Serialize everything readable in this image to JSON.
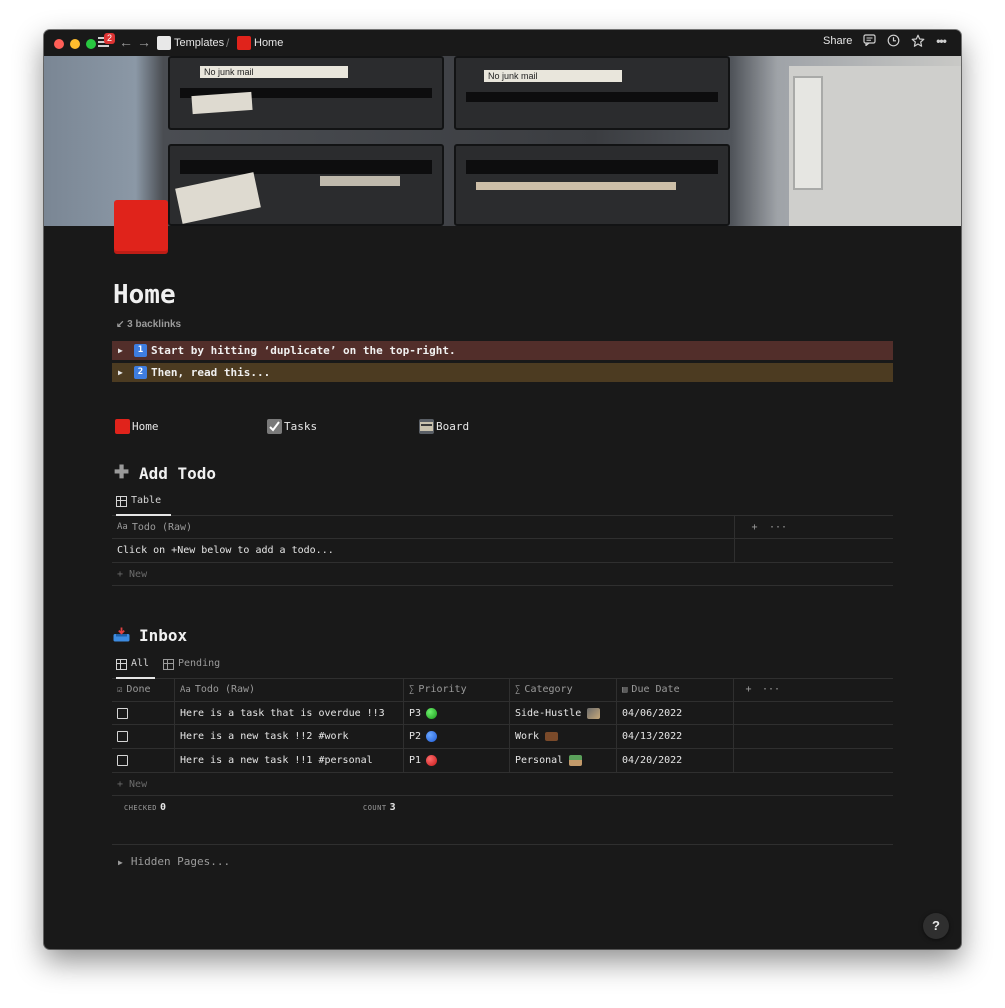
{
  "titlebar": {
    "badge_count": "2",
    "breadcrumb": [
      {
        "label": "Templates"
      },
      {
        "label": "Home"
      }
    ],
    "separator": "/",
    "share_label": "Share",
    "back_glyph": "←",
    "forward_glyph": "→",
    "icons": [
      "comment-icon",
      "clock-icon",
      "star-icon",
      "more-icon"
    ]
  },
  "cover": {
    "mailbox_labels": [
      "No junk mail",
      "No junk mail"
    ]
  },
  "page": {
    "title": "Home",
    "backlinks_arrow": "↙",
    "backlinks": "3 backlinks"
  },
  "callouts": [
    {
      "num": "1",
      "text": "Start by hitting ‘duplicate’ on the top-right.",
      "color": "#522e2a"
    },
    {
      "num": "2",
      "text": "Then, read this...",
      "color": "#4c3b21"
    }
  ],
  "links": [
    {
      "label": "Home"
    },
    {
      "label": "Tasks"
    },
    {
      "label": "Board"
    }
  ],
  "add_todo": {
    "heading": "Add Todo",
    "tab": "Table",
    "column": "Todo (Raw)",
    "hint": "Click on +New below to add a todo...",
    "new_label": "+ New",
    "add_col": "+",
    "more": "···"
  },
  "inbox": {
    "heading": "Inbox",
    "tabs": [
      {
        "label": "All",
        "active": true
      },
      {
        "label": "Pending",
        "active": false
      }
    ],
    "columns": [
      "Done",
      "Todo (Raw)",
      "Priority",
      "Category",
      "Due Date"
    ],
    "column_icons": [
      "☑",
      "Aa",
      "∑",
      "∑",
      "▤"
    ],
    "rows": [
      {
        "todo": "Here is a task that is overdue !!3",
        "priority": "P3",
        "priority_dot": "green",
        "category": "Side-Hustle",
        "due": "04/06/2022"
      },
      {
        "todo": "Here is a new task !!2 #work",
        "priority": "P2",
        "priority_dot": "blue",
        "category": "Work",
        "due": "04/13/2022"
      },
      {
        "todo": "Here is a new task !!1 #personal",
        "priority": "P1",
        "priority_dot": "red",
        "category": "Personal",
        "due": "04/20/2022"
      }
    ],
    "new_label": "+ New",
    "checked_label": "CHECKED",
    "checked_value": "0",
    "count_label": "COUNT",
    "count_value": "3",
    "add_col": "+",
    "more": "···"
  },
  "hidden_pages": {
    "label": "Hidden Pages...",
    "glyph": "▶"
  },
  "help": "?"
}
